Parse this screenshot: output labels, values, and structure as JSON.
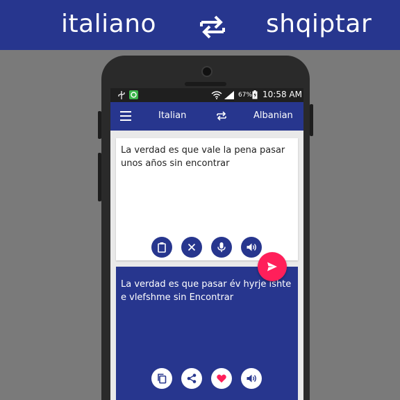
{
  "banner": {
    "source_lang": "italiano",
    "target_lang": "shqiptar"
  },
  "status": {
    "battery": "67%",
    "time": "10:58 AM"
  },
  "appbar": {
    "source_lang": "Italian",
    "target_lang": "Albanian"
  },
  "input": {
    "text": "La verdad es que vale la pena pasar unos años sin encontrar"
  },
  "output": {
    "text": "La verdad es que pasar év hyrje ishte e vlefshme sin Encontrar"
  },
  "icons": {
    "input_actions": [
      "clipboard-icon",
      "clear-icon",
      "microphone-icon",
      "speaker-icon"
    ],
    "translate": "send-icon",
    "output_actions": [
      "copy-icon",
      "share-icon",
      "heart-icon",
      "speaker-icon"
    ]
  },
  "colors": {
    "primary": "#27368e",
    "accent": "#ff1f5a",
    "background": "#7a7a7a"
  }
}
